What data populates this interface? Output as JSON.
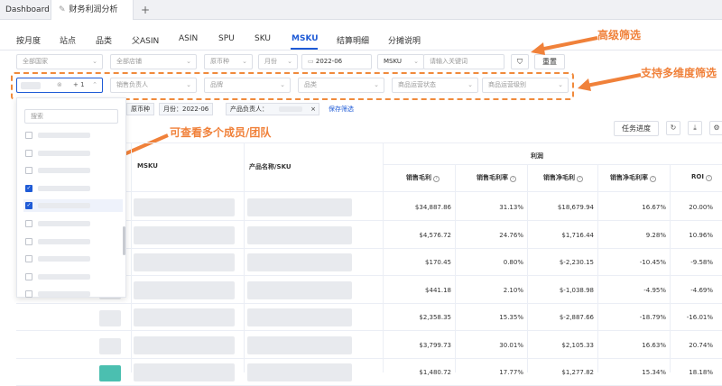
{
  "browser_tabs": {
    "dashboard": "Dashboard",
    "active": "财务利润分析",
    "add": "+"
  },
  "subnav": [
    "按月度",
    "站点",
    "品类",
    "父ASIN",
    "ASIN",
    "SPU",
    "SKU",
    "MSKU",
    "结算明细",
    "分摊说明"
  ],
  "filters_row1": {
    "country": "全部国家",
    "store": "全部店铺",
    "currency": "原币种",
    "period_type": "月份",
    "month": "2022-06",
    "search_type": "MSKU",
    "search_placeholder": "请输入关键词",
    "reset": "重置"
  },
  "filters_row2": {
    "member_count": "+ 1",
    "sales_owner": "销售负责人",
    "brand": "品牌",
    "category": "品类",
    "ops_status": "商品运营状态",
    "ops_level": "商品运营级别"
  },
  "chips": {
    "currency": "原币种",
    "month": "月份：2022-06",
    "owner": "产品负责人：",
    "save": "保存筛选"
  },
  "annotations": {
    "advanced": "高级筛选",
    "multi_dim": "支持多维度筛选",
    "members": "可查看多个成员/团队"
  },
  "dropdown": {
    "search_placeholder": "搜索",
    "items_checked": [
      false,
      false,
      false,
      true,
      true,
      false,
      false,
      false,
      false,
      false
    ]
  },
  "toolbar": {
    "task_progress": "任务进度"
  },
  "table": {
    "group_header": "利润",
    "columns": {
      "msku": "MSKU",
      "product": "产品名称/SKU",
      "gross_profit": "销售毛利",
      "gross_margin": "销售毛利率",
      "net_profit": "销售净毛利",
      "net_margin": "销售净毛利率",
      "roi": "ROI"
    },
    "rows": [
      [
        "$34,887.86",
        "31.13%",
        "$18,679.94",
        "16.67%",
        "20.00%"
      ],
      [
        "$4,576.72",
        "24.76%",
        "$1,716.44",
        "9.28%",
        "10.96%"
      ],
      [
        "$170.45",
        "0.80%",
        "$-2,230.15",
        "-10.45%",
        "-9.58%"
      ],
      [
        "$441.18",
        "2.10%",
        "$-1,038.98",
        "-4.95%",
        "-4.69%"
      ],
      [
        "$2,358.35",
        "15.35%",
        "$-2,887.66",
        "-18.79%",
        "-16.01%"
      ],
      [
        "$3,799.73",
        "30.01%",
        "$2,105.33",
        "16.63%",
        "20.74%"
      ],
      [
        "$1,480.72",
        "17.77%",
        "$1,277.82",
        "15.34%",
        "18.18%"
      ]
    ]
  },
  "colors": {
    "accent": "#1f5bd6",
    "annotation": "#f0813a"
  }
}
